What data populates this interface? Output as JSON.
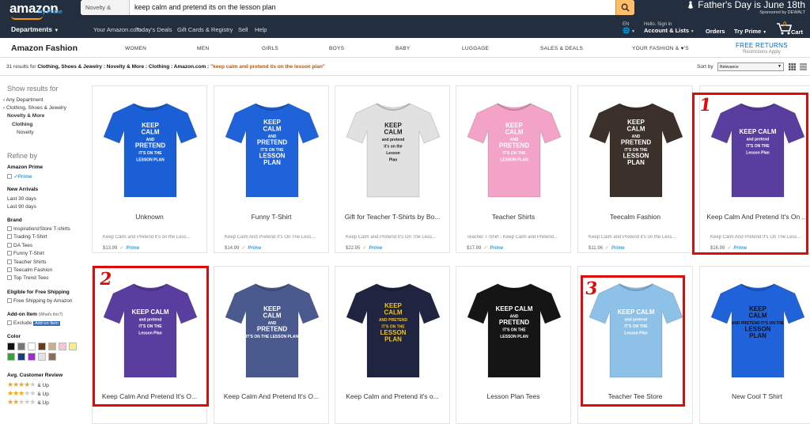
{
  "header": {
    "logo": "amazon",
    "logo_sub": "Try Prime",
    "search_scope": "Novelty & More",
    "search_query": "keep calm and pretend its on the lesson plan",
    "promo_title": "Father's Day is June 18th",
    "promo_sponsor": "Sponsored by DEWALT"
  },
  "nav": {
    "departments": "Departments",
    "links": [
      "Your Amazon.com",
      "Today's Deals",
      "Gift Cards & Registry",
      "Sell",
      "Help"
    ],
    "lang": "EN",
    "hello": "Hello. Sign in",
    "account": "Account & Lists",
    "orders": "Orders",
    "tryprime": "Try Prime",
    "cart_count": "0",
    "cart": "Cart"
  },
  "fashion": {
    "brand": "Amazon Fashion",
    "categories": [
      "WOMEN",
      "MEN",
      "GIRLS",
      "BOYS",
      "BABY",
      "LUGGAGE",
      "SALES & DEALS",
      "YOUR FASHION & ♥'S"
    ],
    "free_returns": "FREE RETURNS",
    "restrictions": "Restrictions Apply"
  },
  "results": {
    "count_text": "31 results for",
    "path": "Clothing, Shoes & Jewelry : Novelty & More : Clothing : Amazon.com :",
    "query": "\"keep calm and pretend its on the lesson plan\"",
    "sort_label": "Sort by",
    "sort_value": "Relevance"
  },
  "sidebar": {
    "show_results_for": "Show results for",
    "cats": [
      "‹ Any Department",
      "‹ Clothing, Shoes & Jewelry",
      "Novelty & More",
      "Clothing",
      "Novelty"
    ],
    "refine_by": "Refine by",
    "amazon_prime": "Amazon Prime",
    "prime_label": "✓Prime",
    "new_arrivals": "New Arrivals",
    "arrivals": [
      "Last 30 days",
      "Last 90 days"
    ],
    "brand": "Brand",
    "brands": [
      "InspirationzStore T-shirts",
      "Trading T-Shirt",
      "DA Tees",
      "Funny T-Shirt",
      "Teacher Shirts",
      "Teecalm Fashion",
      "Top Trend Tees"
    ],
    "free_ship_title": "Eligible for Free Shipping",
    "free_ship": "Free Shipping by Amazon",
    "addon_title": "Add-on Item",
    "addon_whats": "(What's this?)",
    "exclude": "Exclude",
    "addon_badge": "Add-on Item",
    "color": "Color",
    "swatches": [
      "#111111",
      "#777777",
      "#ffffff",
      "#6b3b1d",
      "#c9b08a",
      "#f6c6d4",
      "#f4ef8a",
      "#3aa03a",
      "#1c3c7a",
      "#9b30c9",
      "#e3e3e3",
      "#8b6e5a"
    ],
    "review_title": "Avg. Customer Review",
    "review_up": "& Up"
  },
  "products": [
    {
      "title": "Unknown",
      "desc": "Keep Calm and Pretend it's on the Less...",
      "price": "$13.99",
      "shirt": "#1a5fd6",
      "text": "#ffffff",
      "lines": [
        "KEEP",
        "CALM",
        "AND",
        "PRETEND",
        "IT'S ON THE",
        "LESSON PLAN"
      ]
    },
    {
      "title": "Funny T-Shirt",
      "desc": "Keep Calm And Pretend It's On The Less...",
      "price": "$14.99",
      "shirt": "#1f62d9",
      "text": "#ffffff",
      "lines": [
        "KEEP",
        "CALM",
        "AND",
        "PRETEND",
        "IT'S ON THE",
        "LESSON",
        "PLAN"
      ]
    },
    {
      "title": "Gift for Teacher T-Shirts by Bo...",
      "desc": "Keep Calm and Pretend It's On The Less...",
      "price": "$22.95",
      "shirt": "#e1e1e1",
      "text": "#222222",
      "lines": [
        "KEEP",
        "CALM",
        "and pretend",
        "it's on the",
        "Lesson",
        "Plan"
      ]
    },
    {
      "title": "Teacher Shirts",
      "desc": "Teacher T-Shirt - Keep Calm and Pretend...",
      "price": "$17.99",
      "shirt": "#f3a3c8",
      "text": "#ffffff",
      "lines": [
        "KEEP",
        "CALM",
        "AND",
        "PRETEND",
        "IT'S ON THE",
        "LESSON PLAN"
      ]
    },
    {
      "title": "Teecalm Fashion",
      "desc": "Keep Calm and Pretend it's on the Less...",
      "price": "$11.96",
      "shirt": "#3b302a",
      "text": "#ffffff",
      "lines": [
        "KEEP",
        "CALM",
        "AND",
        "PRETEND",
        "IT'S ON THE",
        "LESSON",
        "PLAN"
      ]
    },
    {
      "title": "Keep Calm And Pretend It's On ...",
      "desc": "Keep Calm And Pretend It's On The Less...",
      "price": "$16.99",
      "shirt": "#5a3e9f",
      "text": "#ffffff",
      "lines": [
        "KEEP CALM",
        "and pretend",
        "IT'S ON THE",
        "Lesson Plan"
      ]
    },
    {
      "title": "Keep Calm And Pretend It's O...",
      "shirt": "#5a3e9f",
      "text": "#ffffff",
      "lines": [
        "KEEP CALM",
        "and pretend",
        "IT'S ON THE",
        "Lesson Plan"
      ]
    },
    {
      "title": "Keep Calm And Pretend It's O...",
      "shirt": "#4b5a8e",
      "text": "#ffffff",
      "lines": [
        "KEEP",
        "CALM",
        "AND",
        "PRETEND",
        "IT'S ON THE LESSON PLAN"
      ]
    },
    {
      "title": "Keep Calm and Pretend it's o...",
      "shirt": "#1f2440",
      "text": "#f4c21b",
      "lines": [
        "KEEP",
        "CALM",
        "AND PRETEND",
        "IT'S ON THE",
        "LESSON",
        "PLAN"
      ]
    },
    {
      "title": "Lesson Plan Tees",
      "shirt": "#151515",
      "text": "#ffffff",
      "lines": [
        "KEEP CALM",
        "AND",
        "PRETEND",
        "IT'S ON THE",
        "LESSON PLAN"
      ]
    },
    {
      "title": "Teacher Tee Store",
      "shirt": "#8ec1e8",
      "text": "#ffffff",
      "lines": [
        "KEEP CALM",
        "and pretend",
        "IT'S ON THE",
        "Lesson Plan"
      ]
    },
    {
      "title": "New Cool T Shirt",
      "shirt": "#1f62d9",
      "text": "#111111",
      "lines": [
        "KEEP",
        "CALM",
        "AND PRETEND IT'S ON THE",
        "LESSON",
        "PLAN"
      ]
    }
  ],
  "annotations": [
    "1",
    "2",
    "3"
  ]
}
